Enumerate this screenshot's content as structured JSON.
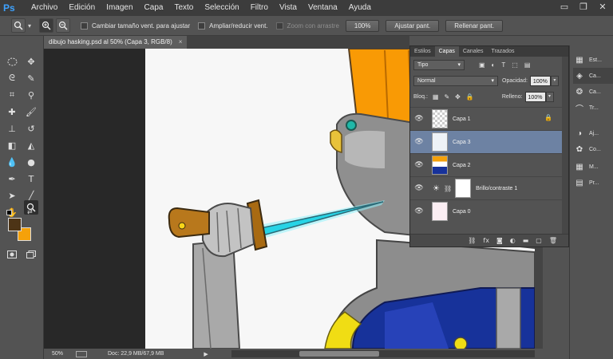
{
  "app": {
    "logo": "Ps"
  },
  "menu": [
    "Archivo",
    "Edición",
    "Imagen",
    "Capa",
    "Texto",
    "Selección",
    "Filtro",
    "Vista",
    "Ventana",
    "Ayuda"
  ],
  "window_controls": {
    "minimize": "▭",
    "restore": "❐",
    "close": "✕"
  },
  "options_bar": {
    "resize_windows_label": "Cambiar tamaño vent. para ajustar",
    "zoom_all_label": "Ampliar/reducir vent.",
    "scrubby_zoom_label": "Zoom con arrastre",
    "zoom_100_label": "100%",
    "fit_screen_label": "Ajustar pant.",
    "fill_screen_label": "Rellenar pant."
  },
  "document": {
    "tab_title": "dibujo hasking.psd al 50% (Capa 3, RGB/8)",
    "close_glyph": "×"
  },
  "status": {
    "zoom": "50%",
    "doc_info": "Doc: 22,9 MB/67,9 MB"
  },
  "colors": {
    "foreground": "#4d3416",
    "background": "#f5a10a",
    "selection": "#6d82a3"
  },
  "layers_panel": {
    "tabs": [
      "Estilos",
      "Capas",
      "Canales",
      "Trazados"
    ],
    "active_tab": "Capas",
    "filter_kind": "Tipo",
    "blend_mode": "Normal",
    "opacity_label": "Opacidad:",
    "opacity_value": "100%",
    "lock_label": "Bloq.:",
    "fill_label": "Relleno:",
    "fill_value": "100%",
    "layers": [
      {
        "name": "Capa 1",
        "locked": true,
        "selected": false,
        "thumb": "checker"
      },
      {
        "name": "Capa 3",
        "locked": false,
        "selected": true,
        "thumb": "figure"
      },
      {
        "name": "Capa 2",
        "locked": false,
        "selected": false,
        "thumb": "figure-color"
      },
      {
        "name": "Brillo/contraste 1",
        "locked": false,
        "selected": false,
        "thumb": "adjustment"
      },
      {
        "name": "Capa 0",
        "locked": false,
        "selected": false,
        "thumb": "sketch"
      }
    ]
  },
  "right_dock": [
    {
      "label": "Est...",
      "icon": "styles-icon"
    },
    {
      "label": "Ca...",
      "icon": "layers-icon"
    },
    {
      "label": "Ca...",
      "icon": "channels-icon"
    },
    {
      "label": "Tr...",
      "icon": "paths-icon"
    },
    {
      "label": "Aj...",
      "icon": "adjustments-icon"
    },
    {
      "label": "Co...",
      "icon": "color-icon"
    },
    {
      "label": "M...",
      "icon": "swatches-icon"
    },
    {
      "label": "Pr...",
      "icon": "properties-icon"
    }
  ]
}
